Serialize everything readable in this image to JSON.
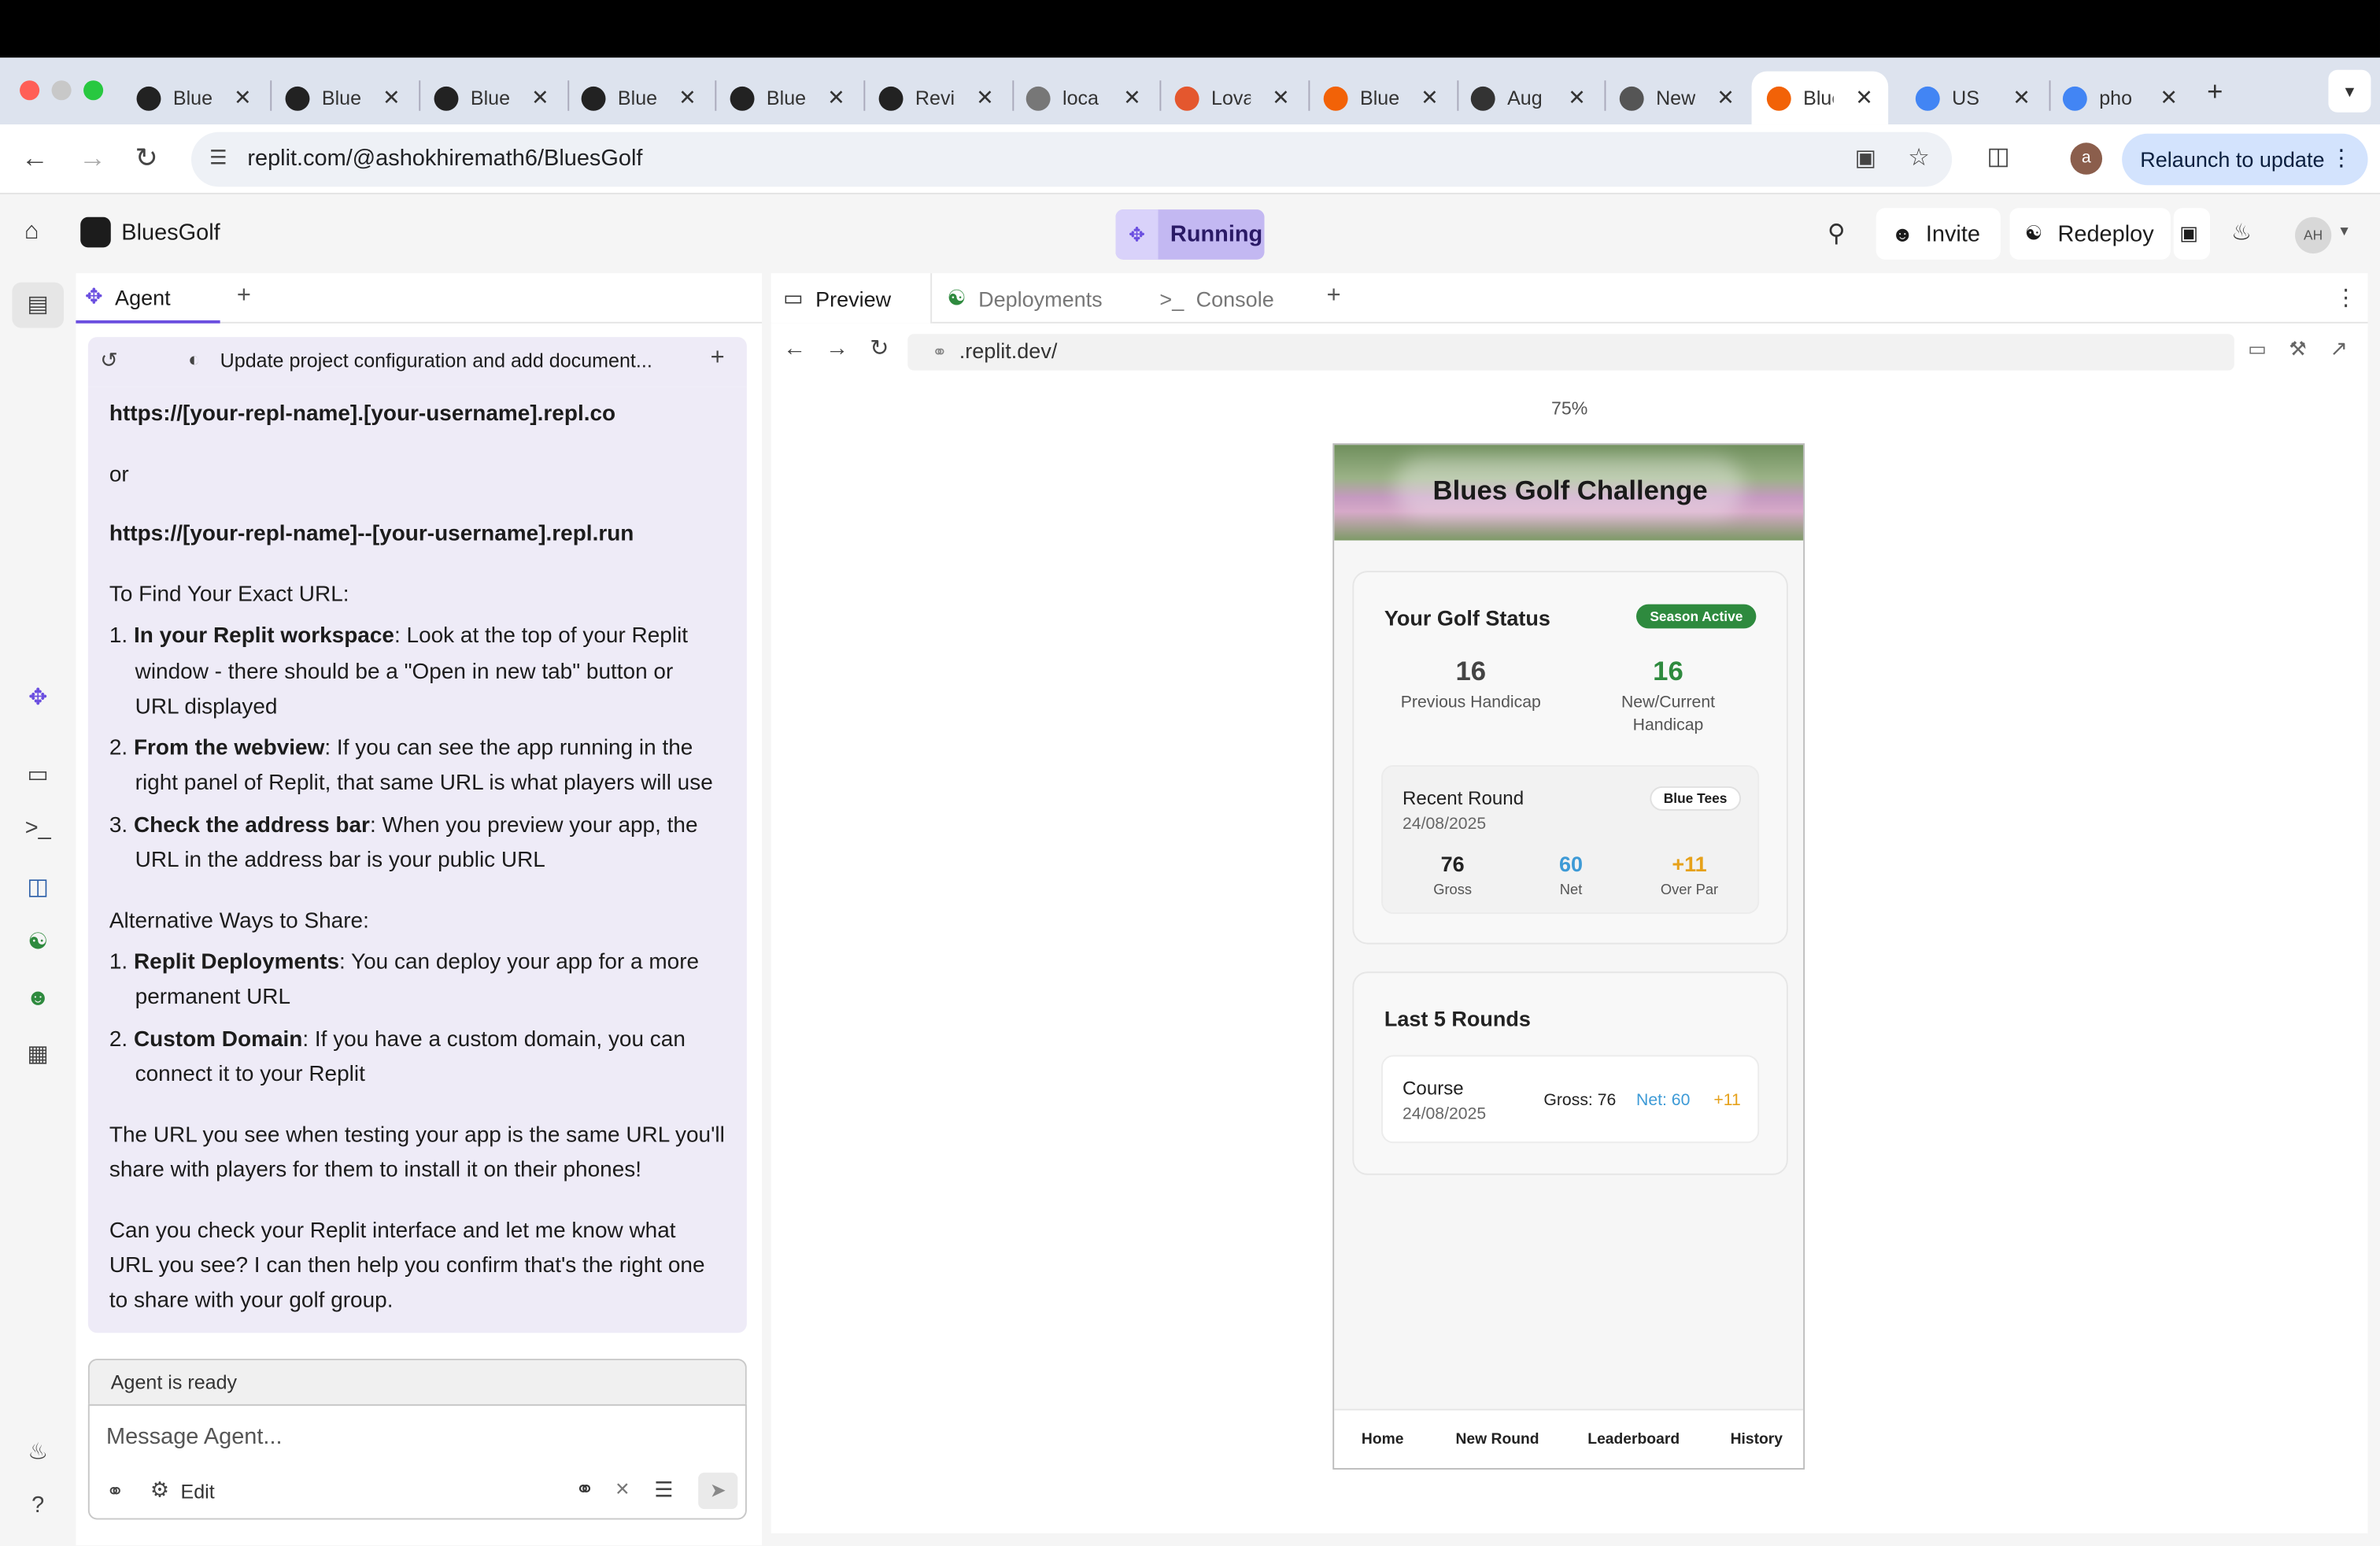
{
  "browser": {
    "tabs": [
      {
        "label": "Blue",
        "icon": "openai-icon",
        "color": "#222"
      },
      {
        "label": "Blue",
        "icon": "anthropic-icon",
        "color": "#222"
      },
      {
        "label": "Blue",
        "icon": "anthropic-icon",
        "color": "#222"
      },
      {
        "label": "Blue",
        "icon": "anthropic-icon",
        "color": "#222"
      },
      {
        "label": "Blue",
        "icon": "anthropic-icon",
        "color": "#222"
      },
      {
        "label": "Revi",
        "icon": "anthropic-icon",
        "color": "#222"
      },
      {
        "label": "loca",
        "icon": "globe-icon",
        "color": "#777"
      },
      {
        "label": "Lova",
        "icon": "heart-icon",
        "color": "#e4572e"
      },
      {
        "label": "Blue",
        "icon": "replit-icon",
        "color": "#f26207"
      },
      {
        "label": "Aug",
        "icon": "app-icon",
        "color": "#333"
      },
      {
        "label": "New",
        "icon": "chrome-icon",
        "color": "#555"
      },
      {
        "label": "Blue",
        "icon": "replit-icon",
        "color": "#f26207"
      },
      {
        "label": "US",
        "icon": "google-icon",
        "color": "#4285f4"
      },
      {
        "label": "pho",
        "icon": "google-icon",
        "color": "#4285f4"
      }
    ],
    "url": "replit.com/@ashokhiremath6/BluesGolf",
    "relaunch_label": "Relaunch to update",
    "profile_initial": "a"
  },
  "replit": {
    "project_name": "BluesGolf",
    "run_status": "Running",
    "invite_label": "Invite",
    "redeploy_label": "Redeploy",
    "avatar_initials": "AH",
    "accent": "#6b4fe0"
  },
  "agent": {
    "tab_label": "Agent",
    "thread_title": "Update project configuration and add document...",
    "lines": [
      {
        "html": "<b>https://[your-repl-name].[your-username].repl.co</b>"
      },
      {
        "html": "or"
      },
      {
        "html": "<b>https://[your-repl-name]--[your-username].repl.run</b>"
      },
      {
        "html": "To Find Your Exact URL:"
      },
      {
        "html": "1. <b>In your Replit workspace</b>: Look at the top of your Replit"
      },
      {
        "html": "window - there should be a \"Open in new tab\" button or"
      },
      {
        "html": "URL displayed"
      },
      {
        "html": "2. <b>From the webview</b>: If you can see the app running in the"
      },
      {
        "html": "right panel of Replit, that same URL is what players will use"
      },
      {
        "html": "3. <b>Check the address bar</b>: When you preview your app, the"
      },
      {
        "html": "URL in the address bar is your public URL"
      },
      {
        "html": "Alternative Ways to Share:"
      },
      {
        "html": "1. <b>Replit Deployments</b>: You can deploy your app for a more"
      },
      {
        "html": "permanent URL"
      },
      {
        "html": "2. <b>Custom Domain</b>: If you have a custom domain, you can"
      },
      {
        "html": "connect it to your Replit"
      },
      {
        "html": "The URL you see when testing your app is the same URL you'll"
      },
      {
        "html": "share with players for them to install it on their phones!"
      },
      {
        "html": "Can you check your Replit interface and let me know what"
      },
      {
        "html": "URL you see? I can then help you confirm that's the right one"
      },
      {
        "html": "to share with your golf group."
      }
    ],
    "status": "Agent is ready",
    "input_placeholder": "Message Agent...",
    "edit_label": "Edit"
  },
  "preview": {
    "tabs": [
      "Preview",
      "Deployments",
      "Console"
    ],
    "url": ".replit.dev/",
    "zoom": "75%"
  },
  "app": {
    "title": "Blues Golf Challenge",
    "status_title": "Your Golf Status",
    "season_badge": "Season Active",
    "prev_handicap": "16",
    "prev_handicap_label": "Previous Handicap",
    "curr_handicap": "16",
    "curr_handicap_label_1": "New/Current",
    "curr_handicap_label_2": "Handicap",
    "recent_title": "Recent Round",
    "recent_date": "24/08/2025",
    "tees": "Blue Tees",
    "gross": "76",
    "gross_label": "Gross",
    "net": "60",
    "net_label": "Net",
    "over_par": "+11",
    "over_par_label": "Over Par",
    "last5_title": "Last 5 Rounds",
    "round_course": "Course",
    "round_date": "24/08/2025",
    "round_gross": "Gross: 76",
    "round_net": "Net: 60",
    "round_over": "+11",
    "nav": [
      "Home",
      "New Round",
      "Leaderboard",
      "History"
    ],
    "colors": {
      "green": "#2e8a3e",
      "blue": "#3d9ad6",
      "orange": "#e6a11a"
    }
  }
}
